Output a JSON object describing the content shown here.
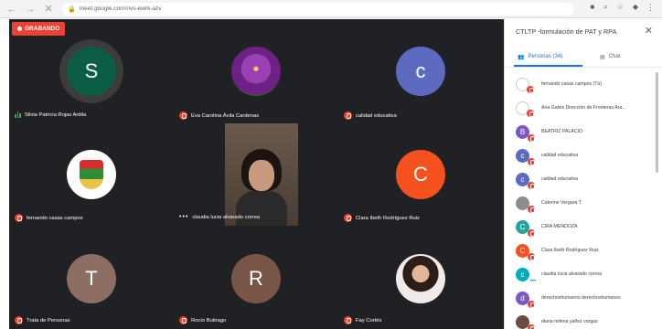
{
  "browser": {
    "url": "meet.google.com/nvs-ewrk-azv"
  },
  "recording": {
    "label": "GRABANDO"
  },
  "tiles": [
    {
      "name": "Silvia Patricia Rojas Ardila",
      "initial": "S",
      "color": "#0b5e45",
      "mic": "active"
    },
    {
      "name": "Eva Carolina Ávila Cardenas",
      "initial": "",
      "color": "",
      "mic": "muted"
    },
    {
      "name": "calidad educativa",
      "initial": "c",
      "color": "#5c6bc0",
      "mic": "muted"
    },
    {
      "name": "fernando casas campos",
      "initial": "",
      "color": "",
      "mic": "muted"
    },
    {
      "name": "claudia lucia alvarado correa",
      "initial": "",
      "color": "",
      "mic": "more"
    },
    {
      "name": "Clara Ibeth Rodríguez Ruiz",
      "initial": "C",
      "color": "#f4511e",
      "mic": "muted"
    },
    {
      "name": "Trata de Personas",
      "initial": "T",
      "color": "#8d6e63",
      "mic": "muted"
    },
    {
      "name": "Rocío Buitrago",
      "initial": "R",
      "color": "#795548",
      "mic": "muted"
    },
    {
      "name": "Fay Cortés",
      "initial": "",
      "color": "",
      "mic": "muted"
    }
  ],
  "panel": {
    "title": "CTLTP -formulación de PAT y RPA",
    "tabs": {
      "people": "Personas (34)",
      "chat": "Chat"
    },
    "participants": [
      {
        "name": "fernando casas campos (Tú)",
        "initial": "",
        "color": "#ffffff"
      },
      {
        "name": "Ana Galvis Dirección de Fronteras Ara...",
        "initial": "",
        "color": "#ffffff"
      },
      {
        "name": "BEATRIZ PALACIO",
        "initial": "B",
        "color": "#7e57c2"
      },
      {
        "name": "calidad educativa",
        "initial": "c",
        "color": "#5c6bc0"
      },
      {
        "name": "calidad educativa",
        "initial": "c",
        "color": "#5c6bc0"
      },
      {
        "name": "Caterine Vergara T.",
        "initial": "",
        "color": "#8d8d8d"
      },
      {
        "name": "CIRA MENDOZA",
        "initial": "C",
        "color": "#26a69a"
      },
      {
        "name": "Clara Ibeth Rodríguez Ruiz",
        "initial": "C",
        "color": "#f4511e"
      },
      {
        "name": "claudia lucia alvarado correa",
        "initial": "c",
        "color": "#00acc1"
      },
      {
        "name": "derechoshumanos derechoshumanos",
        "initial": "d",
        "color": "#7e57c2"
      },
      {
        "name": "diana milena yañez vargas",
        "initial": "",
        "color": "#6d4c41"
      }
    ]
  },
  "colors": {
    "muted": "#ea4335",
    "accent": "#1a73e8",
    "grid_bg": "#202124"
  }
}
